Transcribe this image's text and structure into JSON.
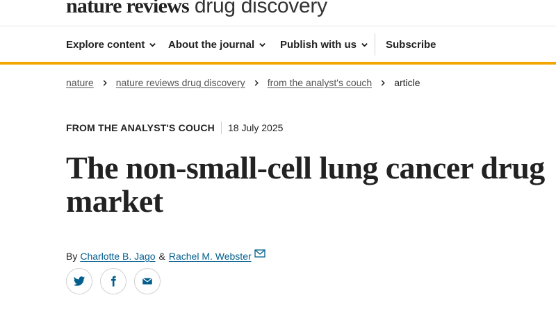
{
  "header": {
    "logo_bold": "nature reviews",
    "logo_light": "drug discovery"
  },
  "nav": {
    "items": [
      {
        "label": "Explore content",
        "icon": "chevron-down-icon"
      },
      {
        "label": "About the journal",
        "icon": "chevron-down-icon"
      },
      {
        "label": "Publish with us",
        "icon": "chevron-down-icon"
      },
      {
        "label": "Subscribe"
      }
    ],
    "accent_color": "#f0a500"
  },
  "breadcrumb": {
    "items": [
      "nature",
      "nature reviews drug discovery",
      "from the analyst's couch"
    ],
    "current": "article"
  },
  "article": {
    "type": "FROM THE ANALYST'S COUCH",
    "date": "18 July 2025",
    "title": "The non-small-cell lung cancer drug market",
    "by_prefix": "By",
    "authors": [
      "Charlotte B. Jago",
      "Rachel M. Webster"
    ],
    "author_separator": "&",
    "link_color": "#025e8d"
  },
  "share": {
    "icons": [
      "twitter-icon",
      "facebook-icon",
      "email-icon"
    ]
  }
}
